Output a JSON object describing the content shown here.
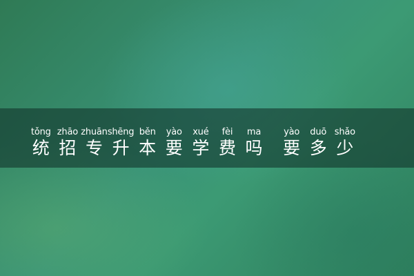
{
  "title": {
    "chars": [
      {
        "pinyin": "tǒng",
        "hanzi": "统"
      },
      {
        "pinyin": "zhāo",
        "hanzi": "招"
      },
      {
        "pinyin": "zhuān",
        "hanzi": "专"
      },
      {
        "pinyin": "shēng",
        "hanzi": "升"
      },
      {
        "pinyin": "běn",
        "hanzi": "本"
      },
      {
        "pinyin": "yào",
        "hanzi": "要"
      },
      {
        "pinyin": "xué",
        "hanzi": "学"
      },
      {
        "pinyin": "fèi",
        "hanzi": "费"
      },
      {
        "pinyin": "ma",
        "hanzi": "吗"
      },
      {
        "pinyin": "yào",
        "hanzi": "要"
      },
      {
        "pinyin": "duō",
        "hanzi": "多"
      },
      {
        "pinyin": "shǎo",
        "hanzi": "少"
      }
    ]
  },
  "colors": {
    "background": "#3a9478",
    "banner": "#14372d",
    "text": "#ffffff"
  }
}
